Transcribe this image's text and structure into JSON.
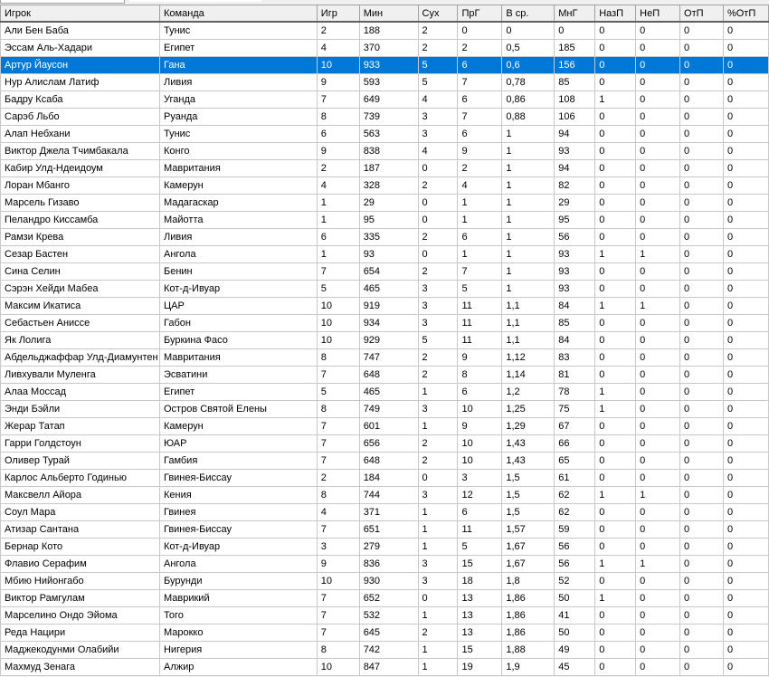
{
  "columns": [
    "Игрок",
    "Команда",
    "Игр",
    "Мин",
    "Сух",
    "ПрГ",
    "В ср.",
    "МнГ",
    "НазП",
    "НеП",
    "ОтП",
    "%ОтП"
  ],
  "selected_row": 2,
  "rows": [
    [
      "Али Бен Баба",
      "Тунис",
      "2",
      "188",
      "2",
      "0",
      "0",
      "0",
      "0",
      "0",
      "0",
      "0"
    ],
    [
      "Эссам Аль-Хадари",
      "Египет",
      "4",
      "370",
      "2",
      "2",
      "0,5",
      "185",
      "0",
      "0",
      "0",
      "0"
    ],
    [
      "Артур Йаусон",
      "Гана",
      "10",
      "933",
      "5",
      "6",
      "0,6",
      "156",
      "0",
      "0",
      "0",
      "0"
    ],
    [
      "Нур Алислам Латиф",
      "Ливия",
      "9",
      "593",
      "5",
      "7",
      "0,78",
      "85",
      "0",
      "0",
      "0",
      "0"
    ],
    [
      "Бадру Ксаба",
      "Уганда",
      "7",
      "649",
      "4",
      "6",
      "0,86",
      "108",
      "1",
      "0",
      "0",
      "0"
    ],
    [
      "Сарэб Льбо",
      "Руанда",
      "8",
      "739",
      "3",
      "7",
      "0,88",
      "106",
      "0",
      "0",
      "0",
      "0"
    ],
    [
      "Алап Небхани",
      "Тунис",
      "6",
      "563",
      "3",
      "6",
      "1",
      "94",
      "0",
      "0",
      "0",
      "0"
    ],
    [
      "Виктор Джела Тчимбакала",
      "Конго",
      "9",
      "838",
      "4",
      "9",
      "1",
      "93",
      "0",
      "0",
      "0",
      "0"
    ],
    [
      "Кабир Улд-Ндеидоум",
      "Мавритания",
      "2",
      "187",
      "0",
      "2",
      "1",
      "94",
      "0",
      "0",
      "0",
      "0"
    ],
    [
      "Лоран Мбанго",
      "Камерун",
      "4",
      "328",
      "2",
      "4",
      "1",
      "82",
      "0",
      "0",
      "0",
      "0"
    ],
    [
      "Марсель Гизаво",
      "Мадагаскар",
      "1",
      "29",
      "0",
      "1",
      "1",
      "29",
      "0",
      "0",
      "0",
      "0"
    ],
    [
      "Пеландро Киссамба",
      "Майотта",
      "1",
      "95",
      "0",
      "1",
      "1",
      "95",
      "0",
      "0",
      "0",
      "0"
    ],
    [
      "Рамзи Крева",
      "Ливия",
      "6",
      "335",
      "2",
      "6",
      "1",
      "56",
      "0",
      "0",
      "0",
      "0"
    ],
    [
      "Сезар Бастен",
      "Ангола",
      "1",
      "93",
      "0",
      "1",
      "1",
      "93",
      "1",
      "1",
      "0",
      "0"
    ],
    [
      "Сина Селин",
      "Бенин",
      "7",
      "654",
      "2",
      "7",
      "1",
      "93",
      "0",
      "0",
      "0",
      "0"
    ],
    [
      "Сэрэн Хейди Мабеа",
      "Кот-д-Ивуар",
      "5",
      "465",
      "3",
      "5",
      "1",
      "93",
      "0",
      "0",
      "0",
      "0"
    ],
    [
      "Максим Икатиса",
      "ЦАР",
      "10",
      "919",
      "3",
      "11",
      "1,1",
      "84",
      "1",
      "1",
      "0",
      "0"
    ],
    [
      "Себастьен Аниссе",
      "Габон",
      "10",
      "934",
      "3",
      "11",
      "1,1",
      "85",
      "0",
      "0",
      "0",
      "0"
    ],
    [
      "Як Лолига",
      "Буркина Фасо",
      "10",
      "929",
      "5",
      "11",
      "1,1",
      "84",
      "0",
      "0",
      "0",
      "0"
    ],
    [
      "Абдельджаффар Улд-Диамунтен",
      "Мавритания",
      "8",
      "747",
      "2",
      "9",
      "1,12",
      "83",
      "0",
      "0",
      "0",
      "0"
    ],
    [
      "Ливхували Муленга",
      "Эсватини",
      "7",
      "648",
      "2",
      "8",
      "1,14",
      "81",
      "0",
      "0",
      "0",
      "0"
    ],
    [
      "Алаа Моссад",
      "Египет",
      "5",
      "465",
      "1",
      "6",
      "1,2",
      "78",
      "1",
      "0",
      "0",
      "0"
    ],
    [
      "Энди Бэйли",
      "Остров Святой Елены",
      "8",
      "749",
      "3",
      "10",
      "1,25",
      "75",
      "1",
      "0",
      "0",
      "0"
    ],
    [
      "Жерар Татап",
      "Камерун",
      "7",
      "601",
      "1",
      "9",
      "1,29",
      "67",
      "0",
      "0",
      "0",
      "0"
    ],
    [
      "Гарри Голдстоун",
      "ЮАР",
      "7",
      "656",
      "2",
      "10",
      "1,43",
      "66",
      "0",
      "0",
      "0",
      "0"
    ],
    [
      "Оливер Турай",
      "Гамбия",
      "7",
      "648",
      "2",
      "10",
      "1,43",
      "65",
      "0",
      "0",
      "0",
      "0"
    ],
    [
      "Карлос Альберто Годинью",
      "Гвинея-Биссау",
      "2",
      "184",
      "0",
      "3",
      "1,5",
      "61",
      "0",
      "0",
      "0",
      "0"
    ],
    [
      "Максвелл Айора",
      "Кения",
      "8",
      "744",
      "3",
      "12",
      "1,5",
      "62",
      "1",
      "1",
      "0",
      "0"
    ],
    [
      "Соул Мара",
      "Гвинея",
      "4",
      "371",
      "1",
      "6",
      "1,5",
      "62",
      "0",
      "0",
      "0",
      "0"
    ],
    [
      "Атизар Сантана",
      "Гвинея-Биссау",
      "7",
      "651",
      "1",
      "11",
      "1,57",
      "59",
      "0",
      "0",
      "0",
      "0"
    ],
    [
      "Бернар Кото",
      "Кот-д-Ивуар",
      "3",
      "279",
      "1",
      "5",
      "1,67",
      "56",
      "0",
      "0",
      "0",
      "0"
    ],
    [
      "Флавио Серафим",
      "Ангола",
      "9",
      "836",
      "3",
      "15",
      "1,67",
      "56",
      "1",
      "1",
      "0",
      "0"
    ],
    [
      "Мбию Нийонгабо",
      "Бурунди",
      "10",
      "930",
      "3",
      "18",
      "1,8",
      "52",
      "0",
      "0",
      "0",
      "0"
    ],
    [
      "Виктор Рамгулам",
      "Маврикий",
      "7",
      "652",
      "0",
      "13",
      "1,86",
      "50",
      "1",
      "0",
      "0",
      "0"
    ],
    [
      "Марселино Ондо Эйома",
      "Того",
      "7",
      "532",
      "1",
      "13",
      "1,86",
      "41",
      "0",
      "0",
      "0",
      "0"
    ],
    [
      "Реда Нацири",
      "Марокко",
      "7",
      "645",
      "2",
      "13",
      "1,86",
      "50",
      "0",
      "0",
      "0",
      "0"
    ],
    [
      "Маджекодунми Олабийи",
      "Нигерия",
      "8",
      "742",
      "1",
      "15",
      "1,88",
      "49",
      "0",
      "0",
      "0",
      "0"
    ],
    [
      "Махмуд Зенага",
      "Алжир",
      "10",
      "847",
      "1",
      "19",
      "1,9",
      "45",
      "0",
      "0",
      "0",
      "0"
    ]
  ]
}
